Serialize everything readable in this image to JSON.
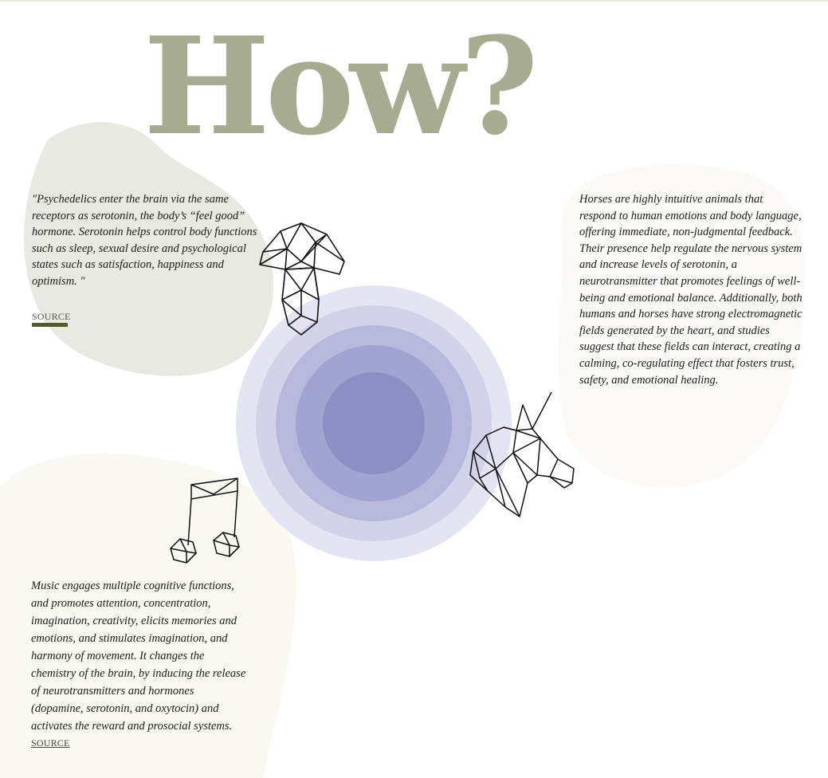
{
  "headline": "How?",
  "sections": {
    "psychedelics": {
      "text": "\"Psychedelics enter the brain via the same receptors as serotonin, the body’s “feel good” hormone. Serotonin helps control body functions such as sleep, sexual desire and psychological states such as satisfaction, happiness and optimism. \"",
      "source_label": "SOURCE",
      "icon": "mushroom-icon"
    },
    "horses": {
      "text": "Horses are highly intuitive animals that respond to human emotions and body language, offering immediate, non-judgmental feedback. Their presence help regulate the nervous system and increase levels of serotonin, a neurotransmitter that promotes feelings of well-being and emotional balance. Additionally, both humans and horses have strong electromagnetic fields generated by the heart, and studies suggest that these fields can interact, creating a calming, co-regulating effect that fosters trust, safety, and emotional healing.",
      "icon": "unicorn-icon"
    },
    "music": {
      "text": "Music engages multiple cognitive functions, and promotes attention, concentration, imagination, creativity, elicits memories and emotions, and stimulates imagination, and harmony of movement. It changes the chemistry of the brain, by inducing the release of neurotransmitters and hormones (dopamine, serotonin, and oxytocin) and activates the reward and prosocial systems.",
      "source_label": "SOURCE",
      "icon": "music-note-icon"
    }
  },
  "colors": {
    "headline": "#a7ab8f",
    "blob_sage": "#e8e9e3",
    "blob_pink": "#fdf9f7",
    "blob_cream": "#faf8f3",
    "circle_outer": "#e4e5f2",
    "circle_inner": "#8d8fc4",
    "source_accent": "#545b2a"
  }
}
